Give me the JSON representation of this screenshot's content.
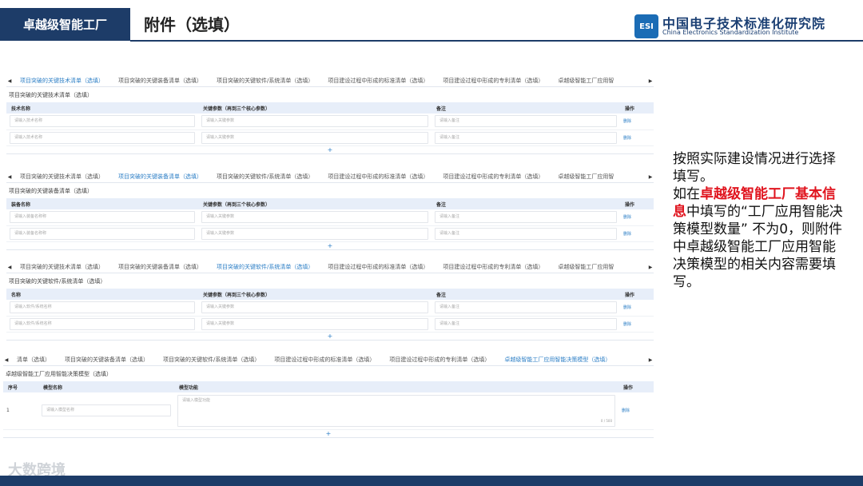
{
  "header": {
    "section": "卓越级智能工厂",
    "title": "附件（选填）",
    "logo_mark": "ESI",
    "org_cn": "中国电子技术标准化研究院",
    "org_en": "China Electronics Standardization Institute"
  },
  "tab_labels": {
    "tech": "项目突破的关键技术清单（选填）",
    "equip": "项目突破的关键装备清单（选填）",
    "soft": "项目突破的关键软件/系统清单（选填）",
    "std": "项目建设过程中形成的标准清单（选填）",
    "patent": "项目建设过程中形成的专利清单（选填）",
    "model_trunc": "卓越级智能工厂应用智",
    "model_full": "卓越级智能工厂应用智能决策模型（选填）",
    "tech_trunc": "清单（选填）"
  },
  "panel1": {
    "section_title": "项目突破的关键技术清单（选填）",
    "headers": [
      "技术名称",
      "关键参数（再到三个核心参数）",
      "备注",
      "操作"
    ],
    "rows": [
      [
        "请输入技术名称",
        "请输入关键参数",
        "请输入备注",
        "删除"
      ],
      [
        "请输入技术名称",
        "请输入关键参数",
        "请输入备注",
        "删除"
      ]
    ],
    "add": "+"
  },
  "panel2": {
    "section_title": "项目突破的关键装备清单（选填）",
    "headers": [
      "装备名称",
      "关键参数（再到三个核心参数）",
      "备注",
      "操作"
    ],
    "rows": [
      [
        "请输入装备名称称",
        "请输入关键参数",
        "请输入备注",
        "删除"
      ],
      [
        "请输入装备名称称",
        "请输入关键参数",
        "请输入备注",
        "删除"
      ]
    ],
    "add": "+"
  },
  "panel3": {
    "section_title": "项目突破的关键软件/系统清单（选填）",
    "headers": [
      "名称",
      "关键参数（再到三个核心参数）",
      "备注",
      "操作"
    ],
    "rows": [
      [
        "请输入软件/系统名称",
        "请输入关键参数",
        "请输入备注",
        "删除"
      ],
      [
        "请输入软件/系统名称",
        "请输入关键参数",
        "请输入备注",
        "删除"
      ]
    ],
    "add": "+"
  },
  "panel4": {
    "section_title": "卓越级智能工厂应用智能决策模型（选填）",
    "headers": [
      "序号",
      "模型名称",
      "模型功能",
      "操作"
    ],
    "row": {
      "index": "1",
      "name_placeholder": "请输入模型名称",
      "func_placeholder": "请输入模型功能",
      "counter": "0 / 500",
      "op": "删除"
    },
    "add": "+"
  },
  "side_note": {
    "part1": "按照实际建设情况进行选择填写。",
    "part2": "如在",
    "highlight": "卓越级智能工厂基本信息",
    "part3": "中填写的“工厂应用智能决策模型数量” 不为0，则附件中卓越级智能工厂应用智能决策模型的相关内容需要填写。"
  },
  "watermark": "大数跨境",
  "colors": {
    "navy": "#1d3c68",
    "accent": "#2d7fc6",
    "highlight": "#e0141e"
  }
}
